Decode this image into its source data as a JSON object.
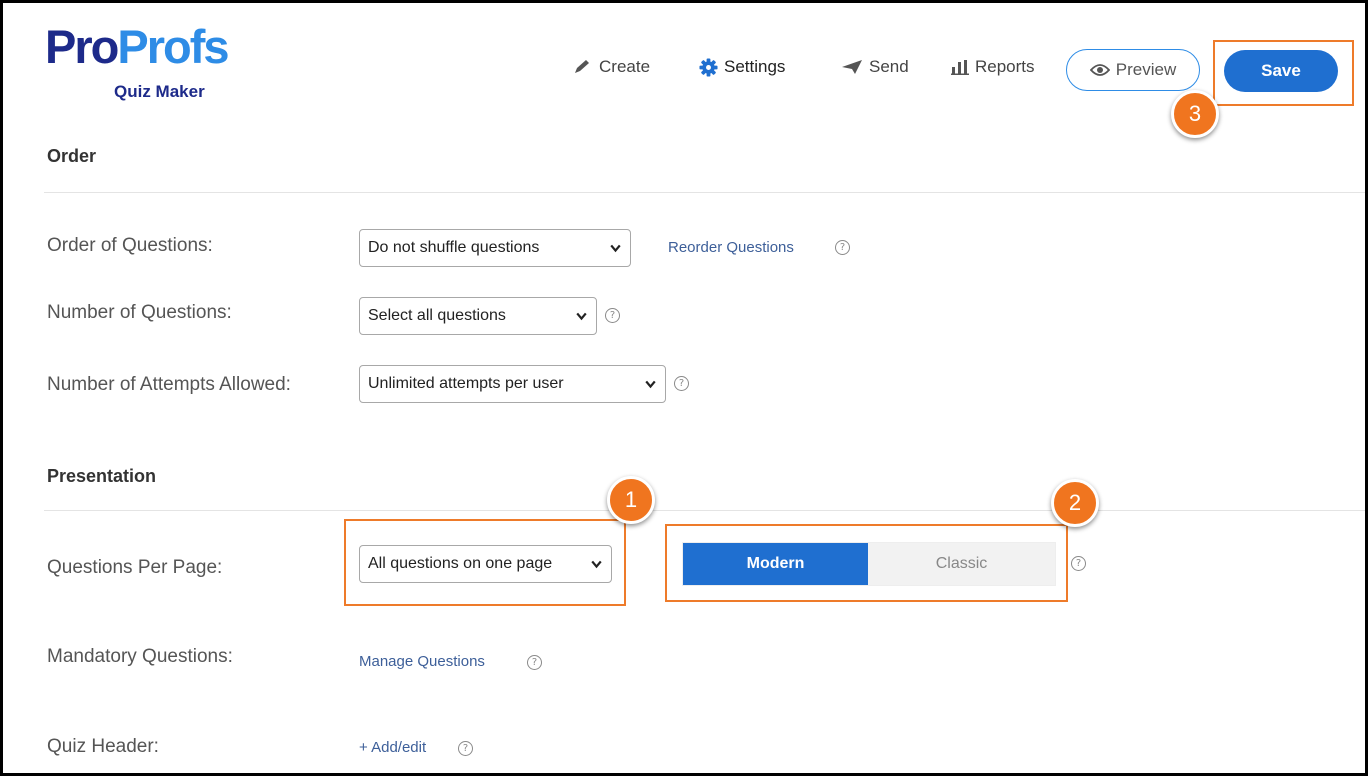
{
  "brand": {
    "pro": "Pro",
    "profs": "Profs",
    "sub": "Quiz Maker"
  },
  "nav": {
    "create": "Create",
    "settings": "Settings",
    "send": "Send",
    "reports": "Reports",
    "preview": "Preview",
    "save": "Save"
  },
  "sections": {
    "order": "Order",
    "presentation": "Presentation"
  },
  "order": {
    "order_label": "Order of Questions:",
    "order_value": "Do not shuffle questions",
    "reorder_link": "Reorder Questions",
    "number_label": "Number of Questions:",
    "number_value": "Select all questions",
    "attempts_label": "Number of Attempts Allowed:",
    "attempts_value": "Unlimited attempts per user"
  },
  "presentation": {
    "per_page_label": "Questions Per Page:",
    "per_page_value": "All questions on one page",
    "mode_modern": "Modern",
    "mode_classic": "Classic",
    "mode_selected": "Modern",
    "mandatory_label": "Mandatory Questions:",
    "mandatory_link": "Manage Questions",
    "header_label": "Quiz Header:",
    "header_link": "+ Add/edit"
  },
  "annotations": {
    "one": "1",
    "two": "2",
    "three": "3"
  },
  "help_glyph": "?",
  "colors": {
    "brand_dark": "#1d2a8a",
    "brand_light": "#2e8ce6",
    "primary": "#1f6fd0",
    "highlight": "#ee7b2a",
    "badge": "#f0751f"
  }
}
